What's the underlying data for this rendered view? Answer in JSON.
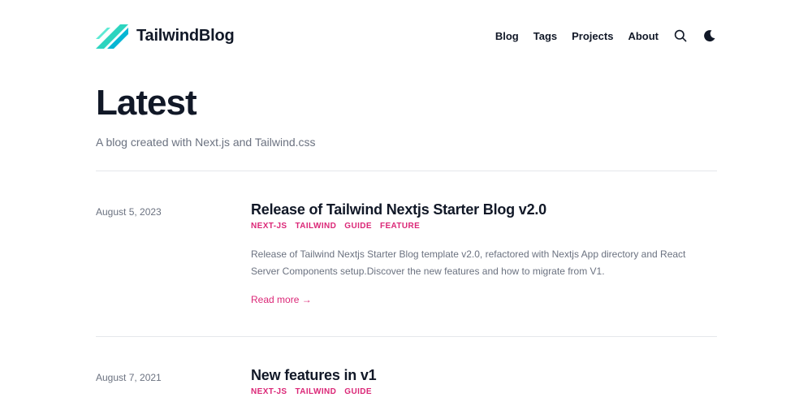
{
  "header": {
    "brand": "TailwindBlog",
    "nav": [
      "Blog",
      "Tags",
      "Projects",
      "About"
    ],
    "icons": [
      "search-icon",
      "moon-icon"
    ]
  },
  "hero": {
    "title": "Latest",
    "subtitle": "A blog created with Next.js and Tailwind.css"
  },
  "posts": [
    {
      "date": "August 5, 2023",
      "title": "Release of Tailwind Nextjs Starter Blog v2.0",
      "tags": [
        "NEXT-JS",
        "TAILWIND",
        "GUIDE",
        "FEATURE"
      ],
      "summary": "Release of Tailwind Nextjs Starter Blog template v2.0, refactored with Nextjs App directory and React Server Components setup.Discover the new features and how to migrate from V1.",
      "read_more": "Read more →"
    },
    {
      "date": "August 7, 2021",
      "title": "New features in v1",
      "tags": [
        "NEXT-JS",
        "TAILWIND",
        "GUIDE"
      ]
    }
  ],
  "colors": {
    "accent": "#db2777",
    "logo_primary": "#2dd4bf",
    "logo_secondary": "#06b6d4",
    "text": "#111827",
    "muted": "#6b7280",
    "divider": "#e5e7eb"
  }
}
